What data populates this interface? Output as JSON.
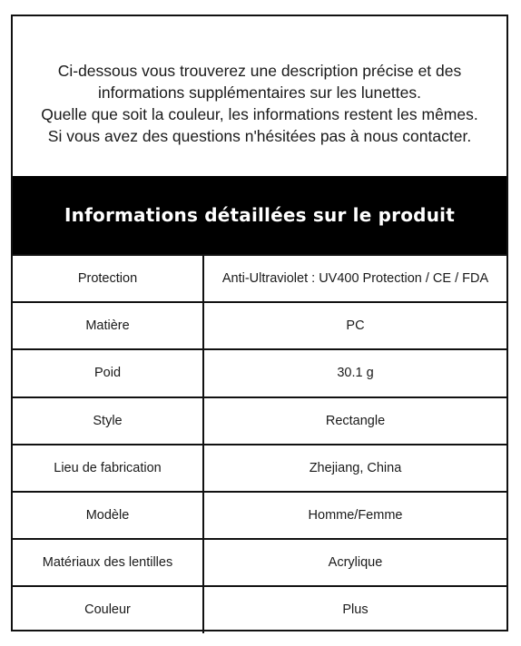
{
  "intro": {
    "lines": [
      "Ci-dessous vous trouverez une description précise et des",
      "informations supplémentaires sur les lunettes.",
      "Quelle que soit la couleur, les informations restent les mêmes.",
      "Si vous avez des questions n'hésitées pas à nous contacter."
    ]
  },
  "banner": {
    "title": "Informations détaillées sur le produit"
  },
  "specs": [
    {
      "label": "Protection",
      "value": "Anti-Ultraviolet : UV400 Protection / CE / FDA"
    },
    {
      "label": "Matière",
      "value": "PC"
    },
    {
      "label": "Poid",
      "value": "30.1 g"
    },
    {
      "label": "Style",
      "value": "Rectangle"
    },
    {
      "label": "Lieu de fabrication",
      "value": "Zhejiang, China"
    },
    {
      "label": "Modèle",
      "value": "Homme/Femme"
    },
    {
      "label": "Matériaux des lentilles",
      "value": "Acrylique"
    },
    {
      "label": "Couleur",
      "value": "Plus"
    }
  ],
  "colors": {
    "banner_background": "#000000",
    "banner_text": "#ffffff",
    "border": "#111111",
    "text": "#1a1a1a"
  }
}
